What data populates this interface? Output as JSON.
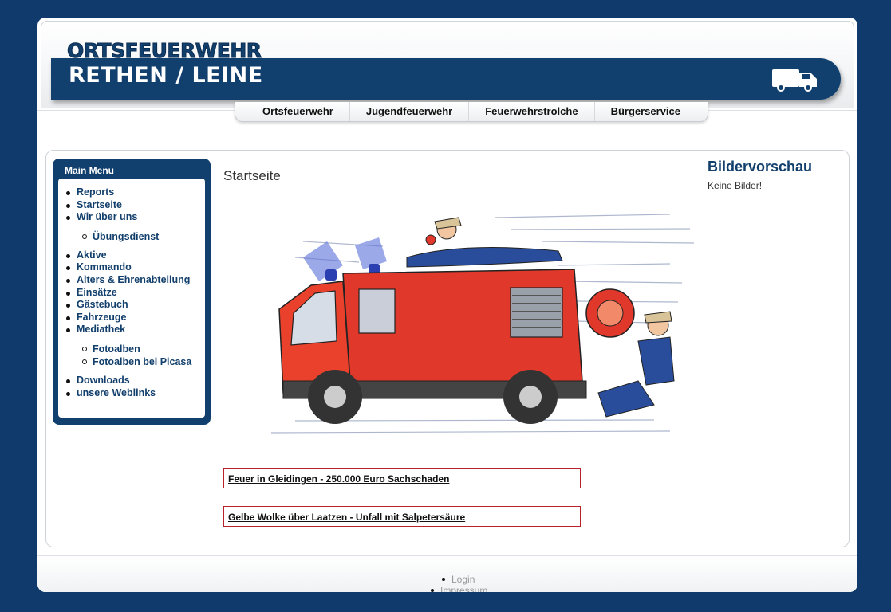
{
  "header": {
    "logo_top": "ORTSFEUERWEHR",
    "logo_main": "RETHEN / LEINE",
    "truck_icon": "fire-truck-icon"
  },
  "nav": {
    "items": [
      "Ortsfeuerwehr",
      "Jugendfeuerwehr",
      "Feuerwehrstrolche",
      "Bürgerservice"
    ]
  },
  "menu": {
    "title": "Main Menu",
    "items1": [
      "Reports",
      "Startseite",
      "Wir über uns"
    ],
    "sub1": [
      "Übungsdienst"
    ],
    "items2": [
      "Aktive",
      "Kommando",
      "Alters & Ehrenabteilung",
      "Einsätze",
      "Gästebuch",
      "Fahrzeuge",
      "Mediathek"
    ],
    "sub2": [
      "Fotoalben",
      "Fotoalben bei Picasa"
    ],
    "items3": [
      "Downloads",
      "unsere Weblinks"
    ]
  },
  "main": {
    "title": "Startseite",
    "news": [
      "Feuer in Gleidingen - 250.000 Euro Sachschaden",
      "Gelbe Wolke über Laatzen - Unfall mit Salpetersäure"
    ]
  },
  "sidebar": {
    "title": "Bildervorschau",
    "text": "Keine Bilder!"
  },
  "footer": {
    "links": [
      "Login",
      "Impressum"
    ]
  },
  "colors": {
    "brand": "#11406f",
    "background": "#103a6b",
    "news_border": "#b8202c"
  }
}
